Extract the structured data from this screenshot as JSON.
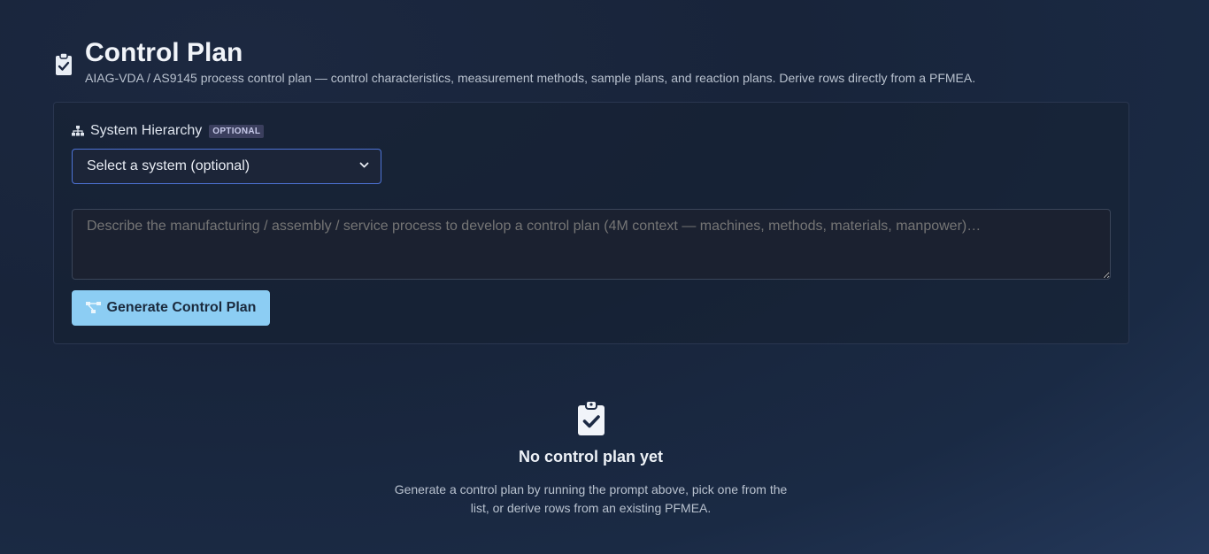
{
  "header": {
    "icon": "clipboard-check-icon",
    "title": "Control Plan",
    "subtitle": "AIAG-VDA / AS9145 process control plan — control characteristics, measurement methods, sample plans, and reaction plans. Derive rows directly from a PFMEA."
  },
  "form": {
    "system_label": "System Hierarchy",
    "system_badge": "OPTIONAL",
    "system_icon": "sitemap-icon",
    "system_select_value": "Select a system (optional)",
    "process_placeholder": "Describe the manufacturing / assembly / service process to develop a control plan (4M context — machines, methods, materials, manpower)…",
    "generate_label": "Generate Control Plan",
    "generate_icon": "diagram-project-icon"
  },
  "empty_state": {
    "icon": "clipboard-check-icon",
    "title": "No control plan yet",
    "text": "Generate a control plan by running the prompt above, pick one from the list, or derive rows from an existing PFMEA."
  },
  "colors": {
    "accent_button": "#8ccdf3",
    "select_border": "#4d73d6",
    "badge_bg": "#3b3f5e"
  }
}
